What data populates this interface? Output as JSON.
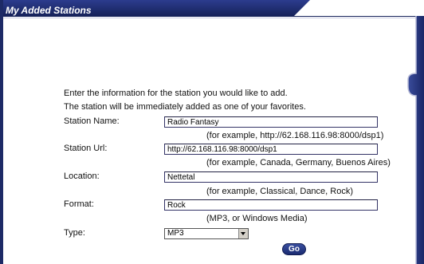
{
  "header": {
    "title": "My Added Stations"
  },
  "form": {
    "intro_line1": "Enter the information for the station you would like to add.",
    "intro_line2": "The station will be immediately added as one of your favorites.",
    "station_name": {
      "label": "Station Name:",
      "value": "Radio Fantasy",
      "hint": "(for example, http://62.168.116.98:8000/dsp1)"
    },
    "station_url": {
      "label": "Station Url:",
      "value": "http://62.168.116.98:8000/dsp1",
      "hint": "(for example, Canada, Germany, Buenos Aires)"
    },
    "location": {
      "label": "Location:",
      "value": "Nettetal",
      "hint": "(for example, Classical, Dance, Rock)"
    },
    "format": {
      "label": "Format:",
      "value": "Rock",
      "hint": "(MP3, or Windows Media)"
    },
    "type": {
      "label": "Type:",
      "selected": "MP3"
    },
    "go_label": "Go"
  },
  "colors": {
    "header_bg": "#1d2a66",
    "accent": "#24348a",
    "button_bg": "#2a3a88"
  }
}
